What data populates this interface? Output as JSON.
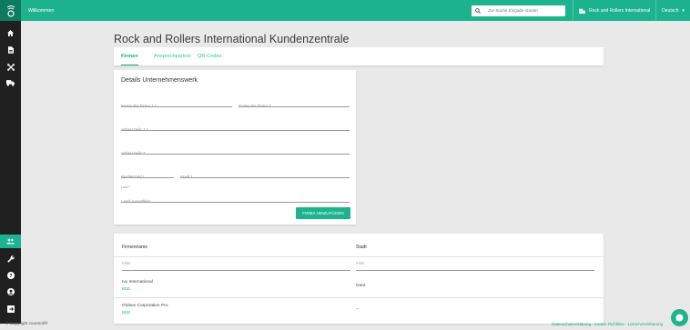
{
  "header": {
    "welcome": "Willkommen",
    "search_placeholder": "Zur Suche Eingabe starten",
    "company": "Rock and Rollers International",
    "language": "Deutsch"
  },
  "page": {
    "title": "Rock and Rollers International Kundenzentrale",
    "tabs": [
      {
        "label": "Firmen",
        "active": true
      },
      {
        "label": "Ansprechpartner",
        "active": false
      },
      {
        "label": "QR-Codes",
        "active": false
      }
    ]
  },
  "form": {
    "title": "Details Unternehmenswerk",
    "name1": "Name der Firma 1 *",
    "name2": "Name der Firma 2",
    "address1": "Adresszeile 1 *",
    "address2": "Adresszeile 2",
    "postcode": "Postleitzahl *",
    "city": "Stadt *",
    "country_small": "Land *",
    "country_placeholder": "Land auswählen...",
    "submit": "FIRMA HINZUFÜGEN"
  },
  "table": {
    "columns": [
      "Firmenname",
      "Stadt"
    ],
    "filter_placeholder": "Filter",
    "rows": [
      {
        "name": "Ivy International",
        "sub": "BSD",
        "city": "Gent"
      },
      {
        "name": "Globex Corporation Pro",
        "sub": "BSD",
        "city": "--"
      }
    ]
  },
  "footer": {
    "copyright": "© Copyright countroll®",
    "links": "Datenschutzerklärung - Cookie-Richtlinie - Lizenzvereinbarung"
  },
  "colors": {
    "accent": "#1db38f",
    "sidebar": "#202020"
  }
}
